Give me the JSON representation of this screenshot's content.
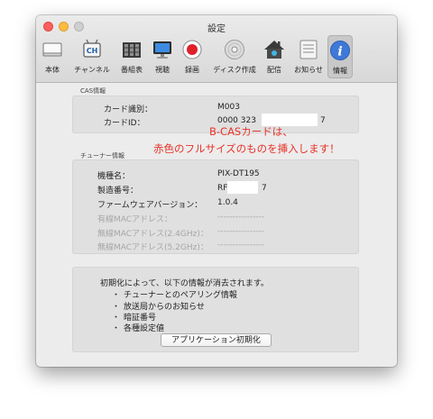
{
  "window": {
    "title": "設定"
  },
  "toolbar": {
    "items": [
      {
        "label": "本体",
        "icon": "device-icon"
      },
      {
        "label": "チャンネル",
        "icon": "channel-ch-icon"
      },
      {
        "label": "番組表",
        "icon": "program-guide-icon"
      },
      {
        "label": "視聴",
        "icon": "monitor-icon"
      },
      {
        "label": "録画",
        "icon": "record-icon"
      },
      {
        "label": "ディスク作成",
        "icon": "disc-icon"
      },
      {
        "label": "配信",
        "icon": "home-broadcast-icon"
      },
      {
        "label": "お知らせ",
        "icon": "notice-icon"
      },
      {
        "label": "情報",
        "icon": "info-icon",
        "selected": true
      }
    ]
  },
  "cas": {
    "section_label": "CAS情報",
    "card_type_label": "カード識別：",
    "card_type_value": "M003",
    "card_id_label": "カードID：",
    "card_id_value_start": "0000 323",
    "card_id_value_end": "7"
  },
  "annotation": {
    "line1": "B-CASカードは、",
    "line2": "赤色のフルサイズのものを挿入します！",
    "color": "#e83228"
  },
  "tuner": {
    "section_label": "チューナー情報",
    "model_label": "機種名：",
    "model_value": "PIX-DT195",
    "serial_label": "製造番号：",
    "serial_value_start": "RF",
    "serial_value_end": "7",
    "firmware_label": "ファームウェアバージョン：",
    "firmware_value": "1.0.4",
    "wired_mac_label": "有線MACアドレス：",
    "wired_mac_value": "----------------",
    "wifi24_mac_label": "無線MACアドレス(2.4GHz)：",
    "wifi24_mac_value": "----------------",
    "wifi5_mac_label": "無線MACアドレス(5.2GHz)：",
    "wifi5_mac_value": "----------------"
  },
  "reset": {
    "intro": "初期化によって、以下の情報が消去されます。",
    "items": [
      "チューナーとのペアリング情報",
      "放送局からのお知らせ",
      "暗証番号",
      "各種設定値"
    ],
    "bullet": "・",
    "button_label": "アプリケーション初期化"
  }
}
